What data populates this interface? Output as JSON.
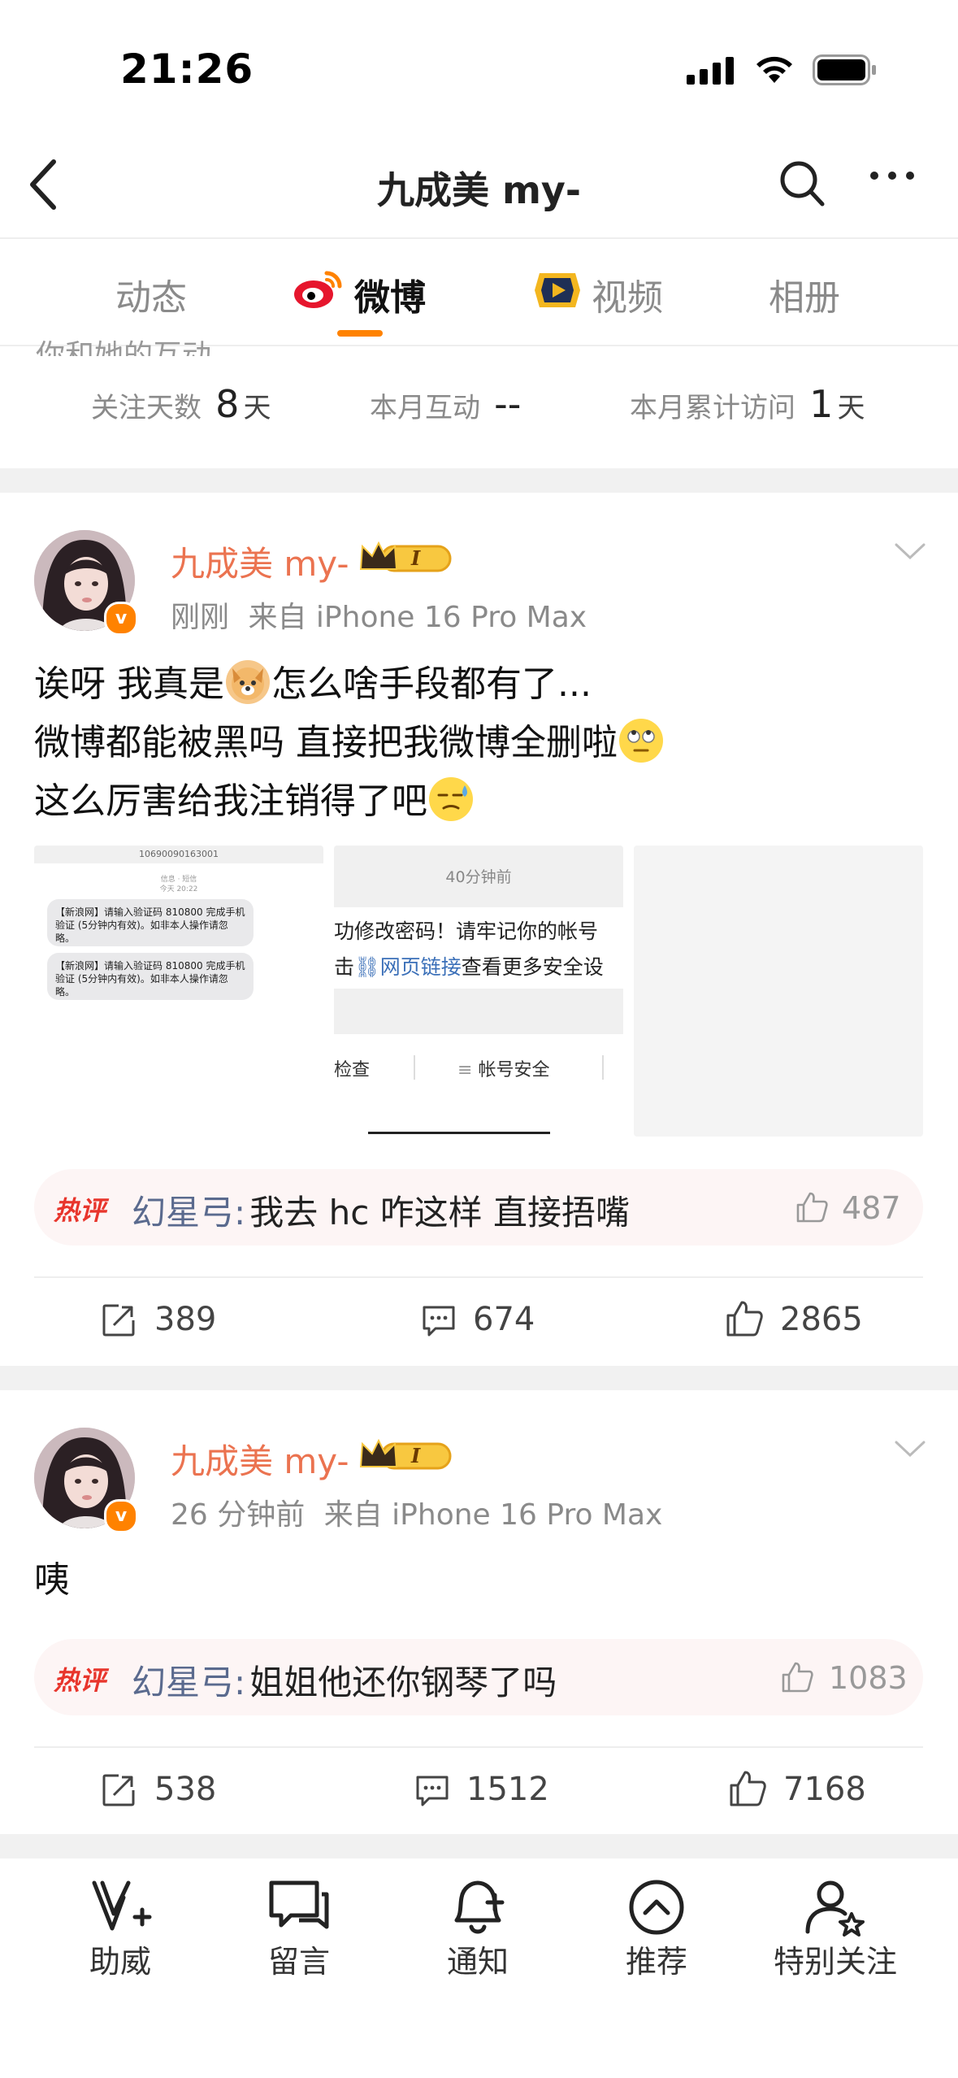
{
  "status_bar": {
    "time": "21:26"
  },
  "nav": {
    "title": "九成美 my-"
  },
  "tabs": [
    {
      "label": "动态"
    },
    {
      "label": "微博"
    },
    {
      "label": "视频"
    },
    {
      "label": "相册"
    }
  ],
  "interaction": {
    "header_cut": "你和她的互动",
    "stats": [
      {
        "label": "关注天数",
        "value": "8",
        "unit": "天"
      },
      {
        "label": "本月互动",
        "value": "--",
        "unit": ""
      },
      {
        "label": "本月累计访问",
        "value": "1",
        "unit": "天"
      }
    ]
  },
  "posts": [
    {
      "author": "九成美 my-",
      "level_badge": "I",
      "time": "刚刚",
      "source": "来自 iPhone 16 Pro Max",
      "lines": [
        {
          "before": "诶呀 我真是",
          "emoji": "dog-emoji",
          "after": "怎么啥手段都有了..."
        },
        {
          "before": "微博都能被黑吗 直接把我微博全删啦",
          "emoji": "eye-roll-emoji",
          "after": ""
        },
        {
          "before": "这么厉害给我注销得了吧",
          "emoji": "sweat-emoji",
          "after": ""
        }
      ],
      "images": {
        "sms": {
          "number": "10690090163001",
          "sub": "信息 · 短信",
          "time": "今天 20:22",
          "messages": [
            "【新浪网】请输入验证码 810800 完成手机验证 (5分钟内有效)。如非本人操作请忽略。",
            "【新浪网】请输入验证码 810800 完成手机验证 (5分钟内有效)。如非本人操作请忽略。"
          ]
        },
        "notice": {
          "time": "40分钟前",
          "line1": "功修改密码！请牢记你的帐号",
          "line2_prefix": "击",
          "link": "网页链接",
          "line2_suffix": "查看更多安全设",
          "btn_left": "检查",
          "btn_right": "帐号安全"
        }
      },
      "hot_comment": {
        "tag": "热评",
        "user": "幻星弓:",
        "text": "我去 hc 咋这样 直接捂嘴",
        "likes": "487"
      },
      "actions": {
        "reposts": "389",
        "comments": "674",
        "likes": "2865"
      }
    },
    {
      "author": "九成美 my-",
      "level_badge": "I",
      "time": "26 分钟前",
      "source": "来自 iPhone 16 Pro Max",
      "text": "咦",
      "hot_comment": {
        "tag": "热评",
        "user": "幻星弓:",
        "text": "姐姐他还你钢琴了吗",
        "likes": "1083"
      },
      "actions": {
        "reposts": "538",
        "comments": "1512",
        "likes": "7168"
      }
    }
  ],
  "tabbar": [
    {
      "label": "助威",
      "icon": "v-plus-icon"
    },
    {
      "label": "留言",
      "icon": "message-icon"
    },
    {
      "label": "通知",
      "icon": "bell-plus-icon"
    },
    {
      "label": "推荐",
      "icon": "chevron-up-circle-icon"
    },
    {
      "label": "特别关注",
      "icon": "user-star-icon"
    }
  ],
  "colors": {
    "accent": "#ff8200",
    "author": "#eb7350",
    "link": "#5a6a8e",
    "hot": "#e8352c"
  }
}
